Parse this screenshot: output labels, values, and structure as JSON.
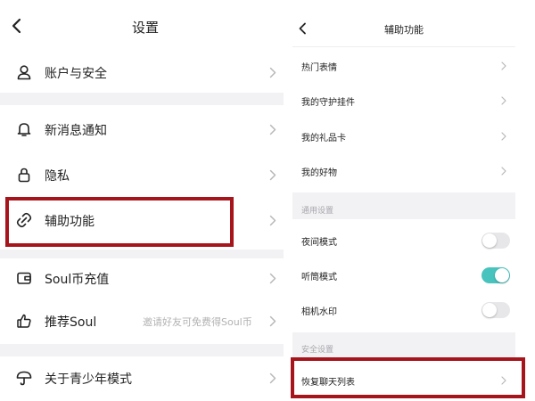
{
  "left_screen": {
    "title": "设置",
    "items": [
      {
        "label": "账户与安全",
        "icon": "user-icon"
      },
      {
        "label": "新消息通知",
        "icon": "bell-icon"
      },
      {
        "label": "隐私",
        "icon": "lock-icon"
      },
      {
        "label": "辅助功能",
        "icon": "link-icon"
      },
      {
        "label": "Soul币充值",
        "icon": "wallet-icon"
      },
      {
        "label": "推荐Soul",
        "icon": "thumbs-up-icon",
        "hint": "邀请好友可免费得Soul币"
      },
      {
        "label": "关于青少年模式",
        "icon": "umbrella-icon"
      }
    ]
  },
  "right_screen": {
    "title": "辅助功能",
    "items": [
      {
        "label": "热门表情"
      },
      {
        "label": "我的守护挂件"
      },
      {
        "label": "我的礼品卡"
      },
      {
        "label": "我的好物"
      }
    ],
    "general_section_title": "通用设置",
    "toggles": [
      {
        "label": "夜间模式",
        "on": false
      },
      {
        "label": "听筒模式",
        "on": true
      },
      {
        "label": "相机水印",
        "on": false
      }
    ],
    "security_section_title": "安全设置",
    "restore_item": {
      "label": "恢复聊天列表"
    }
  },
  "colors": {
    "highlight": "#a6151c",
    "toggle_on": "#48c3be",
    "section_bg": "#f2f2f4"
  }
}
